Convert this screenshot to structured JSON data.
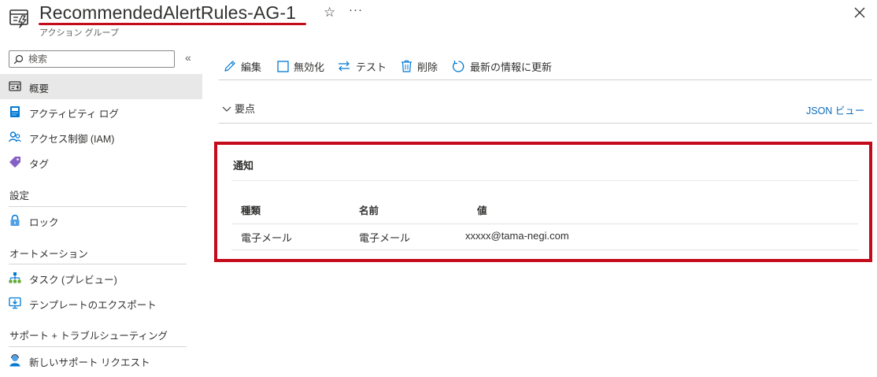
{
  "header": {
    "title": "RecommendedAlertRules-AG-1",
    "subtitle": "アクション グループ",
    "icon": "action-group-icon",
    "highlight_color": "#c40b1b"
  },
  "sidebar": {
    "search_placeholder": "検索",
    "items": [
      {
        "label": "概要",
        "icon": "overview-icon",
        "selected": true
      },
      {
        "label": "アクティビティ ログ",
        "icon": "activity-log-icon"
      },
      {
        "label": "アクセス制御 (IAM)",
        "icon": "access-control-icon"
      },
      {
        "label": "タグ",
        "icon": "tag-icon"
      }
    ],
    "sections": [
      {
        "title": "設定",
        "items": [
          {
            "label": "ロック",
            "icon": "lock-icon"
          }
        ]
      },
      {
        "title": "オートメーション",
        "items": [
          {
            "label": "タスク (プレビュー)",
            "icon": "tasks-icon"
          },
          {
            "label": "テンプレートのエクスポート",
            "icon": "export-template-icon"
          }
        ]
      },
      {
        "title": "サポート + トラブルシューティング",
        "items": [
          {
            "label": "新しいサポート リクエスト",
            "icon": "support-request-icon"
          }
        ]
      }
    ]
  },
  "toolbar": {
    "edit": "編集",
    "disable": "無効化",
    "test": "テスト",
    "delete": "削除",
    "refresh": "最新の情報に更新"
  },
  "essentials": {
    "label": "要点",
    "json_view": "JSON ビュー"
  },
  "notifications": {
    "title": "通知",
    "columns": [
      "種類",
      "名前",
      "値"
    ],
    "rows": [
      [
        "電子メール",
        "電子メール",
        "xxxxx@tama-negi.com"
      ]
    ]
  },
  "colors": {
    "accent": "#0f6cbd",
    "highlight_border": "#c40b1b",
    "selected_nav": "#e8e8e8"
  }
}
